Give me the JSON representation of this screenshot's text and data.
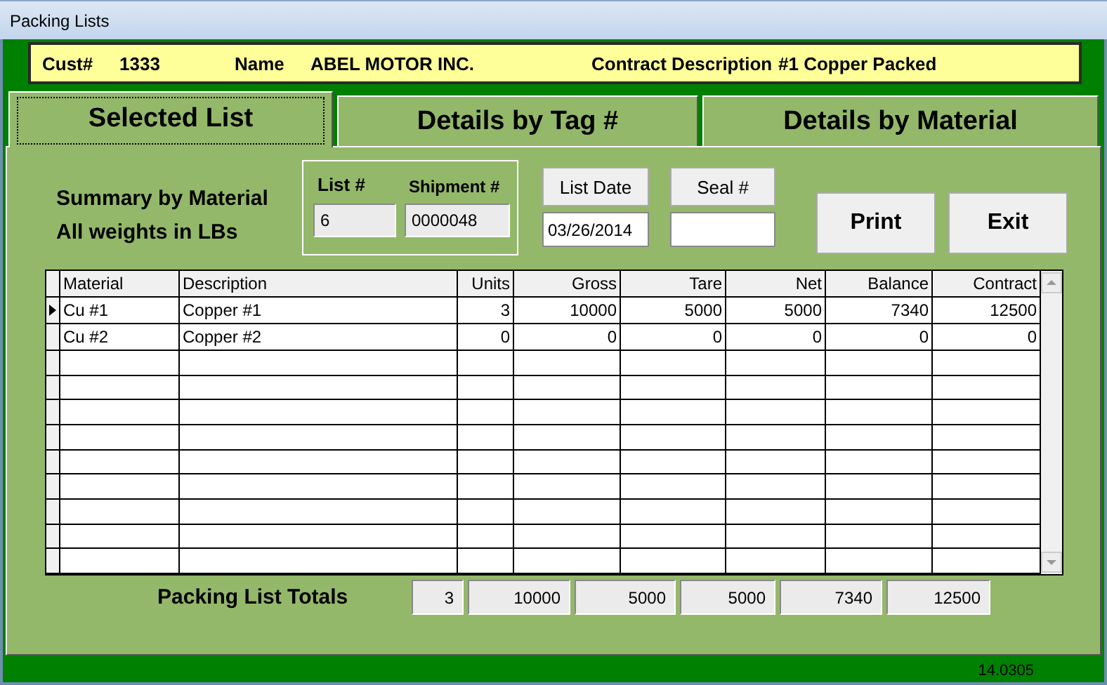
{
  "window": {
    "title": "Packing Lists"
  },
  "header": {
    "cust_label": "Cust#",
    "cust": "1333",
    "name_label": "Name",
    "name": "ABEL MOTOR INC.",
    "contract_label": "Contract Description",
    "contract": "#1 Copper Packed"
  },
  "tabs": [
    {
      "label": "Selected List",
      "selected": true
    },
    {
      "label": "Details by Tag #",
      "selected": false
    },
    {
      "label": "Details by Material",
      "selected": false
    }
  ],
  "summary": {
    "title": "Summary by Material",
    "subtitle": "All weights in LBs"
  },
  "list_field": {
    "label": "List #",
    "value": "6"
  },
  "shipment_field": {
    "label": "Shipment #",
    "value": "0000048"
  },
  "list_date": {
    "button": "List Date",
    "value": "03/26/2014"
  },
  "seal": {
    "button": "Seal #"
  },
  "buttons": [
    "Print",
    "Exit"
  ],
  "table": {
    "columns": [
      "Material",
      "Description",
      "Units",
      "Gross",
      "Tare",
      "Net",
      "Balance",
      "Contract"
    ],
    "rows": [
      {
        "selected": true,
        "cells": [
          "Cu #1",
          "Copper #1",
          "3",
          "10000",
          "5000",
          "5000",
          "7340",
          "12500"
        ]
      },
      {
        "selected": false,
        "cells": [
          "Cu #2",
          "Copper #2",
          "0",
          "0",
          "0",
          "0",
          "0",
          "0"
        ]
      }
    ]
  },
  "totals": {
    "label": "Packing List Totals",
    "values": [
      "3",
      "10000",
      "5000",
      "5000",
      "7340",
      "12500"
    ]
  },
  "status_bar": {
    "version": "14.0305"
  }
}
